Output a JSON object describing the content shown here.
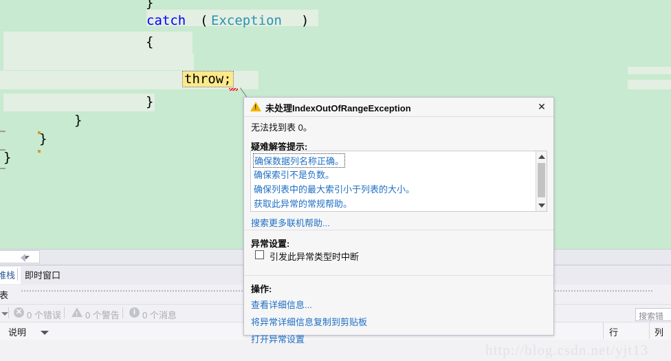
{
  "editor": {
    "lines": [
      {
        "text": "}",
        "kind": "plain"
      },
      {
        "text": "catch",
        "kind": "kw"
      },
      {
        "text": "(",
        "kind": "plain"
      },
      {
        "text": "Exception",
        "kind": "type"
      },
      {
        "text": ")",
        "kind": "plain"
      },
      {
        "text": "{",
        "kind": "plain"
      },
      {
        "text": "}",
        "kind": "plain"
      },
      {
        "text": "}",
        "kind": "plain"
      },
      {
        "text": "}",
        "kind": "plain"
      },
      {
        "text": "}",
        "kind": "plain"
      }
    ],
    "throw_statement": "throw;",
    "colors": {
      "background": "#c8ead0",
      "band": "#e2efe2",
      "keyword": "#0000ff",
      "type": "#2b91af",
      "highlight": "#fbe98a"
    }
  },
  "dialog": {
    "title": "未处理IndexOutOfRangeException",
    "close_label": "✕",
    "message": "无法找到表 0。",
    "tips_title": "疑难解答提示:",
    "tips": [
      "确保数据列名称正确。",
      "确保索引不是负数。",
      "确保列表中的最大索引小于列表的大小。",
      "获取此异常的常规帮助。"
    ],
    "more_help": "搜索更多联机帮助...",
    "exception_settings_title": "异常设置:",
    "break_checkbox_label": "引发此异常类型时中断",
    "break_checkbox_checked": false,
    "actions_title": "操作:",
    "actions": [
      "查看详细信息...",
      "将异常详细信息复制到剪贴板",
      "打开异常设置"
    ],
    "warning_icon": "warning-triangle-icon"
  },
  "panels": {
    "tabs": [
      {
        "label": "堆栈",
        "active": true
      },
      {
        "label": "即时窗口",
        "active": false
      }
    ],
    "list_label": "列表",
    "errors": [
      {
        "icon": "error-icon",
        "label": "0 个错误"
      },
      {
        "icon": "warning-icon",
        "label": "0 个警告"
      },
      {
        "icon": "info-icon",
        "label": "0 个消息"
      }
    ],
    "search_placeholder": "搜索错",
    "columns": [
      {
        "label": "说明"
      },
      {
        "label": "行"
      },
      {
        "label": "列"
      }
    ]
  },
  "watermark": "http://blog.csdn.net/yjt13"
}
